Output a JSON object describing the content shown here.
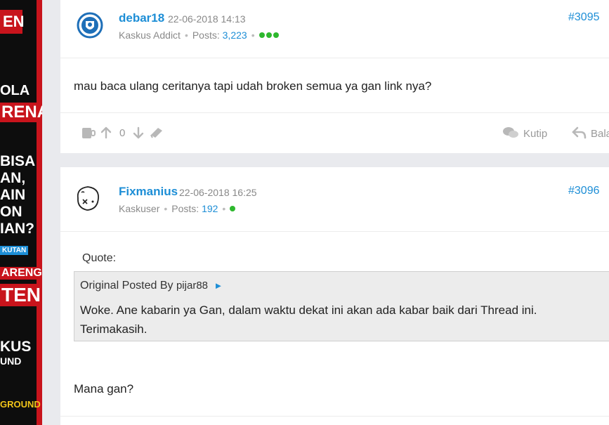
{
  "ad": {
    "lines": [
      "EN",
      "OLA",
      "RENA",
      "BISA",
      "AN,",
      "AIN",
      "ON",
      "IAN?",
      "KUTAN",
      "ARENG",
      "TEN",
      "KUS",
      "UND",
      "GROUND"
    ]
  },
  "posts": [
    {
      "username": "debar18",
      "timestamp": "22-06-2018 14:13",
      "rank": "Kaskus Addict",
      "posts_label": "Posts:",
      "posts_count": "3,223",
      "post_number": "#3095",
      "body": "mau baca ulang ceritanya tapi udah broken semua ya gan link nya?",
      "vote_count": "0",
      "quote_label": "Kutip",
      "reply_label": "Bala"
    },
    {
      "username": "Fixmanius",
      "timestamp": "22-06-2018 16:25",
      "rank": "Kaskuser",
      "posts_label": "Posts:",
      "posts_count": "192",
      "post_number": "#3096",
      "quote_title": "Quote:",
      "quote_original": "Original Posted By",
      "quote_author": "pijar88",
      "quote_arrow": "►",
      "quote_line1": "Woke. Ane kabarin ya Gan, dalam waktu dekat ini akan ada kabar baik dari Thread ini.",
      "quote_line2": "Terimakasih.",
      "body": "Mana gan?"
    }
  ],
  "colors": {
    "accent": "#1d8ed6",
    "online": "#2eb82e",
    "ad_red": "#c8141c"
  }
}
